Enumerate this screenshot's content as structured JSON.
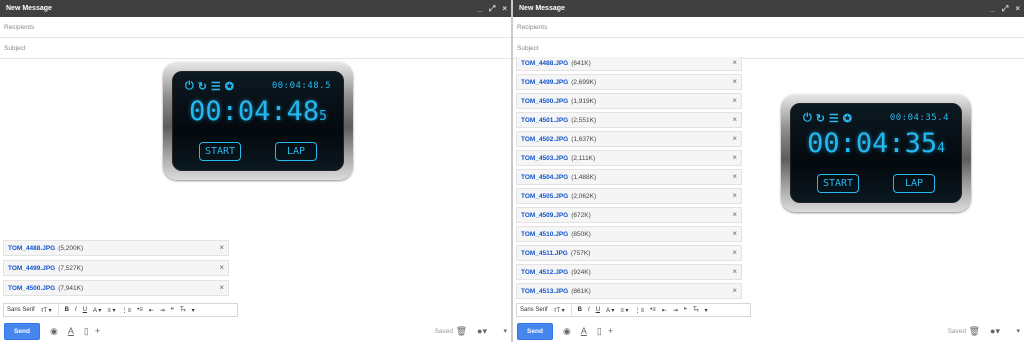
{
  "left": {
    "title": "New Message",
    "window_controls": {
      "minimize": "_",
      "popout": "⤢",
      "close": "×"
    },
    "recipients_placeholder": "Recipients",
    "subject_placeholder": "Subject",
    "stopwatch": {
      "small_time": "00:04:48.5",
      "big_time": "00:04:48",
      "big_fraction": "5",
      "start_label": "START",
      "lap_label": "LAP",
      "icons": [
        "power-icon",
        "refresh-icon",
        "menu-icon",
        "gear-icon"
      ]
    },
    "attachments": [
      {
        "name": "TOM_4488.JPG",
        "size": "(5,200K)"
      },
      {
        "name": "TOM_4499.JPG",
        "size": "(7,527K)"
      },
      {
        "name": "TOM_4500.JPG",
        "size": "(7,941K)"
      }
    ],
    "font_label": "Sans Serif",
    "send_label": "Send",
    "saved_label": "Saved"
  },
  "right": {
    "title": "New Message",
    "window_controls": {
      "minimize": "_",
      "popout": "⤢",
      "close": "×"
    },
    "recipients_placeholder": "Recipients",
    "subject_placeholder": "Subject",
    "stopwatch": {
      "small_time": "00:04:35.4",
      "big_time": "00:04:35",
      "big_fraction": "4",
      "start_label": "START",
      "lap_label": "LAP"
    },
    "attachments": [
      {
        "name": "TOM_4488.JPG",
        "size": "(641K)"
      },
      {
        "name": "TOM_4499.JPG",
        "size": "(2,699K)"
      },
      {
        "name": "TOM_4500.JPG",
        "size": "(1,919K)"
      },
      {
        "name": "TOM_4501.JPG",
        "size": "(2,551K)"
      },
      {
        "name": "TOM_4502.JPG",
        "size": "(1,637K)"
      },
      {
        "name": "TOM_4503.JPG",
        "size": "(2,111K)"
      },
      {
        "name": "TOM_4504.JPG",
        "size": "(1,488K)"
      },
      {
        "name": "TOM_4505.JPG",
        "size": "(2,062K)"
      },
      {
        "name": "TOM_4509.JPG",
        "size": "(672K)"
      },
      {
        "name": "TOM_4510.JPG",
        "size": "(850K)"
      },
      {
        "name": "TOM_4511.JPG",
        "size": "(757K)"
      },
      {
        "name": "TOM_4512.JPG",
        "size": "(924K)"
      },
      {
        "name": "TOM_4513.JPG",
        "size": "(861K)"
      }
    ],
    "font_label": "Sans Serif",
    "send_label": "Send",
    "saved_label": "Saved"
  },
  "colors": {
    "accent": "#4787ed",
    "titlebar": "#404040",
    "link": "#1155cc",
    "lcd": "#22b8f0"
  }
}
